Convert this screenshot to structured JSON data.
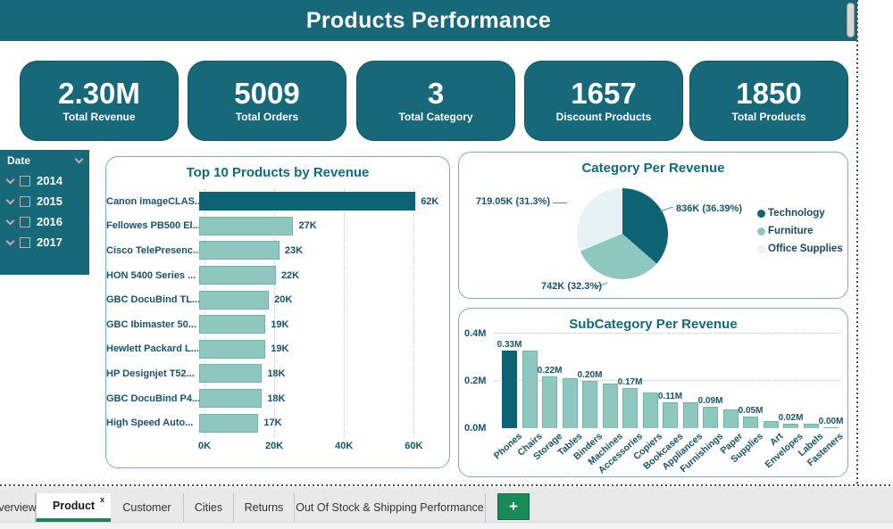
{
  "header": {
    "title": "Products Performance"
  },
  "kpis": [
    {
      "value": "2.30M",
      "label": "Total Revenue"
    },
    {
      "value": "5009",
      "label": "Total Orders"
    },
    {
      "value": "3",
      "label": "Total Category"
    },
    {
      "value": "1657",
      "label": "Discount Products"
    },
    {
      "value": "1850",
      "label": "Total Products"
    }
  ],
  "date_slicer": {
    "title": "Date",
    "items": [
      {
        "label": "2014",
        "checked": false
      },
      {
        "label": "2015",
        "checked": false
      },
      {
        "label": "2016",
        "checked": false
      },
      {
        "label": "2017",
        "checked": false
      }
    ]
  },
  "chart_data": [
    {
      "type": "bar",
      "orientation": "horizontal",
      "title": "Top 10 Products by Revenue",
      "categories": [
        "Canon imageCLAS...",
        "Fellowes PB500 El...",
        "Cisco TelePresenc...",
        "HON 5400 Series ...",
        "GBC DocuBind TL...",
        "GBC Ibimaster 50...",
        "Hewlett Packard L...",
        "HP Designjet T52...",
        "GBC DocuBind P4...",
        "High Speed Auto..."
      ],
      "values": [
        62,
        27,
        23,
        22,
        20,
        19,
        19,
        18,
        18,
        17
      ],
      "value_labels": [
        "62K",
        "27K",
        "23K",
        "22K",
        "20K",
        "19K",
        "19K",
        "18K",
        "18K",
        "17K"
      ],
      "unit": "K",
      "x_ticks": [
        {
          "label": "0K",
          "value": 0
        },
        {
          "label": "20K",
          "value": 20
        },
        {
          "label": "40K",
          "value": 40
        },
        {
          "label": "60K",
          "value": 60
        }
      ],
      "xlim": [
        0,
        64
      ],
      "highlight_index": 0,
      "grid": true
    },
    {
      "type": "pie",
      "title": "Category Per Revenue",
      "legend_position": "right",
      "slices": [
        {
          "label": "Technology",
          "callout": "836K (36.39%)",
          "value_k": 836,
          "pct": 36.39,
          "color": "#0d6374"
        },
        {
          "label": "Furniture",
          "callout": "742K (32.3%)",
          "value_k": 742,
          "pct": 32.3,
          "color": "#8ec7be"
        },
        {
          "label": "Office Supplies",
          "callout": "719.05K (31.3%)",
          "value_k": 719.05,
          "pct": 31.3,
          "color": "#e8f1f4"
        }
      ]
    },
    {
      "type": "bar",
      "orientation": "vertical",
      "title": "SubCategory Per Revenue",
      "categories": [
        "Phones",
        "Chairs",
        "Storage",
        "Tables",
        "Binders",
        "Machines",
        "Accessories",
        "Copiers",
        "Bookcases",
        "Appliances",
        "Furnishings",
        "Paper",
        "Supplies",
        "Art",
        "Envelopes",
        "Labels",
        "Fasteners"
      ],
      "values": [
        0.33,
        0.33,
        0.22,
        0.21,
        0.2,
        0.19,
        0.17,
        0.15,
        0.11,
        0.11,
        0.09,
        0.08,
        0.05,
        0.03,
        0.02,
        0.02,
        0.005
      ],
      "data_labels": [
        "0.33M",
        "",
        "0.22M",
        "",
        "0.20M",
        "",
        "0.17M",
        "",
        "0.11M",
        "",
        "0.09M",
        "",
        "0.05M",
        "",
        "0.02M",
        "",
        "0.00M"
      ],
      "unit": "M",
      "y_ticks": [
        {
          "label": "0.0M",
          "value": 0
        },
        {
          "label": "0.2M",
          "value": 0.2
        },
        {
          "label": "0.4M",
          "value": 0.4
        }
      ],
      "ylim": [
        0,
        0.44
      ],
      "highlight_index": 0,
      "grid": true
    }
  ],
  "tabs": {
    "items": [
      {
        "label": "verview",
        "active": false,
        "partial": true
      },
      {
        "label": "Product",
        "active": true,
        "close_label": "x"
      },
      {
        "label": "Customer",
        "active": false
      },
      {
        "label": "Cities",
        "active": false
      },
      {
        "label": "Returns",
        "active": false
      },
      {
        "label": "Out Of Stock & Shipping Performance",
        "active": false
      }
    ],
    "add_button_label": "+"
  },
  "colors": {
    "teal_primary": "#17697a",
    "series_dark": "#0d6374",
    "series_light": "#8ec7be",
    "series_pale": "#e8f1f4",
    "accent_green": "#1a8a57",
    "label_dark": "#16536e"
  }
}
